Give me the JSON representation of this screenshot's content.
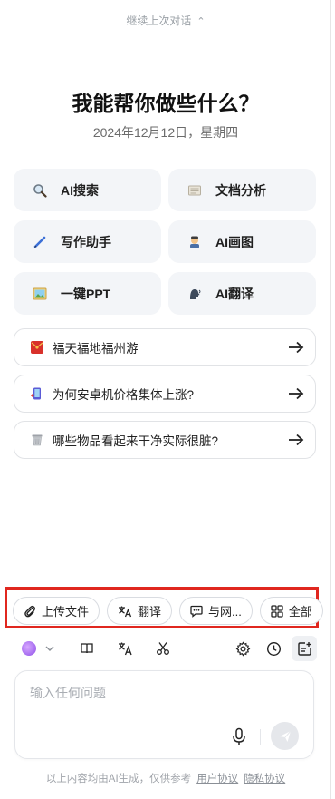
{
  "top": {
    "continue_label": "继续上次对话",
    "continue_icon": "chevron-double-up-icon"
  },
  "hero": {
    "title": "我能帮你做些什么？",
    "date": "2024年12月12日，星期四"
  },
  "quick_actions": [
    {
      "label": "AI搜索",
      "icon": "magnifier-icon"
    },
    {
      "label": "文档分析",
      "icon": "document-icon"
    },
    {
      "label": "写作助手",
      "icon": "pen-icon"
    },
    {
      "label": "AI画图",
      "icon": "artist-icon"
    },
    {
      "label": "一键PPT",
      "icon": "picture-icon"
    },
    {
      "label": "AI翻译",
      "icon": "speaking-head-icon"
    }
  ],
  "suggestions": [
    {
      "label": "福天福地福州游",
      "icon": "red-envelope-icon",
      "color": "#d8312b"
    },
    {
      "label": "为何安卓机价格集体上涨?",
      "icon": "phone-icon",
      "color": "#5b5bd6"
    },
    {
      "label": "哪些物品看起来干净实际很脏?",
      "icon": "trash-bin-icon",
      "color": "#b9bcc2"
    }
  ],
  "chips": [
    {
      "label": "上传文件",
      "icon": "paperclip-icon"
    },
    {
      "label": "翻译",
      "icon": "translate-icon"
    },
    {
      "label": "与网...",
      "icon": "chat-icon"
    },
    {
      "label": "全部",
      "icon": "grid-icon"
    }
  ],
  "input": {
    "placeholder": "输入任何问题"
  },
  "footer": {
    "disclaimer": "以上内容均由AI生成，仅供参考",
    "link1": "用户协议",
    "link2": "隐私协议"
  },
  "colors": {
    "highlight": "#e0271f",
    "accent": "#8e4fe8"
  }
}
